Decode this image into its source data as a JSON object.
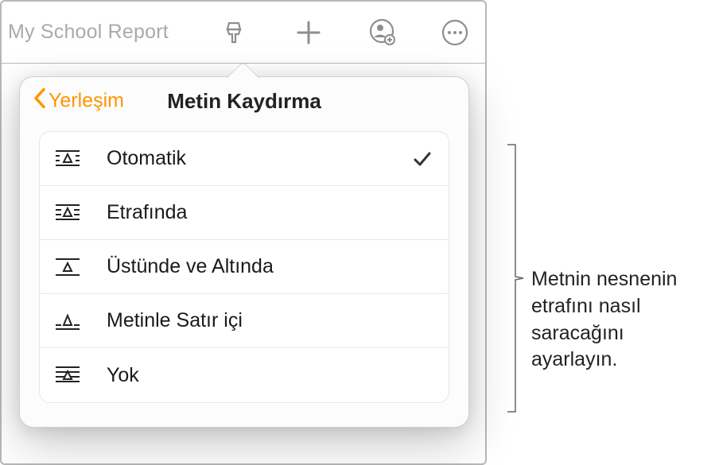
{
  "toolbar": {
    "doc_title": "My School Report"
  },
  "popover": {
    "back_label": "Yerleşim",
    "title": "Metin Kaydırma",
    "options": [
      {
        "label": "Otomatik",
        "selected": true
      },
      {
        "label": "Etrafında",
        "selected": false
      },
      {
        "label": "Üstünde ve Altında",
        "selected": false
      },
      {
        "label": "Metinle Satır içi",
        "selected": false
      },
      {
        "label": "Yok",
        "selected": false
      }
    ]
  },
  "callout": {
    "text": "Metnin nesnenin etrafını nasıl saracağını ayarlayın."
  }
}
